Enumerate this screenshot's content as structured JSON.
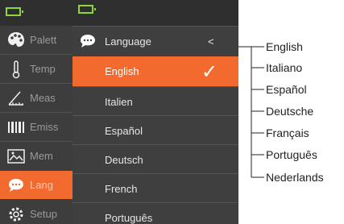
{
  "back_menu": {
    "items": [
      {
        "label": "Palett",
        "icon": "palette-icon"
      },
      {
        "label": "Temp",
        "icon": "thermometer-icon"
      },
      {
        "label": "Meas",
        "icon": "measure-icon"
      },
      {
        "label": "Emiss",
        "icon": "emissivity-icon"
      },
      {
        "label": "Mem",
        "icon": "image-icon"
      },
      {
        "label": "Lang",
        "icon": "speech-bubble-icon",
        "active": true
      },
      {
        "label": "Setup",
        "icon": "gear-icon"
      }
    ]
  },
  "language_menu": {
    "title": "Language",
    "back_symbol": "<",
    "check_symbol": "✓",
    "options": [
      "English",
      "Italien",
      "Español",
      "Deutsch",
      "French",
      "Português"
    ],
    "selected": "English"
  },
  "callouts": [
    "English",
    "Italiano",
    "Español",
    "Deutsche",
    "Français",
    "Português",
    "Nederlands"
  ],
  "colors": {
    "accent": "#f26a2e",
    "battery": "#8ed63a",
    "panel": "#3f3f3f"
  }
}
